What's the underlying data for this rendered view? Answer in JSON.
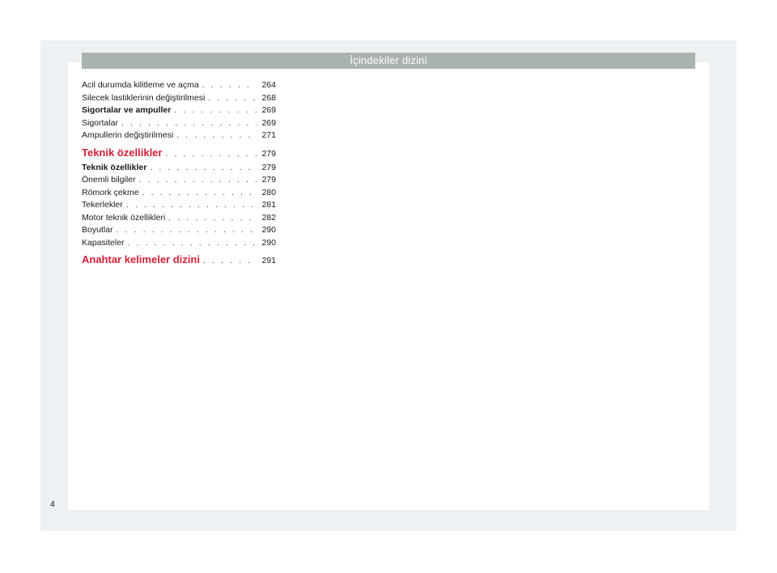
{
  "header": {
    "title": "İçindekiler dizini"
  },
  "toc": [
    {
      "label": "Acil durumda kilitleme ve açma",
      "page": "264",
      "style": "normal"
    },
    {
      "label": "Silecek lastiklerinin değiştirilmesi",
      "page": "268",
      "style": "normal"
    },
    {
      "label": "Sigortalar ve ampuller",
      "page": "269",
      "style": "bold"
    },
    {
      "label": "Sigortalar",
      "page": "269",
      "style": "normal"
    },
    {
      "label": "Ampullerin değiştirilmesi",
      "page": "271",
      "style": "normal"
    },
    {
      "label": "Teknik özellikler",
      "page": "279",
      "style": "section"
    },
    {
      "label": "Teknik özellikler",
      "page": "279",
      "style": "bold"
    },
    {
      "label": "Önemli bilgiler",
      "page": "279",
      "style": "normal"
    },
    {
      "label": "Römork çekme",
      "page": "280",
      "style": "normal"
    },
    {
      "label": "Tekerlekler",
      "page": "281",
      "style": "normal"
    },
    {
      "label": "Motor teknik özellikleri",
      "page": "282",
      "style": "normal"
    },
    {
      "label": "Boyutlar",
      "page": "290",
      "style": "normal"
    },
    {
      "label": "Kapasiteler",
      "page": "290",
      "style": "normal"
    },
    {
      "label": "Anahtar kelimeler dizini",
      "page": "291",
      "style": "section"
    }
  ],
  "footer": {
    "page_number": "4"
  },
  "colors": {
    "header_bar": "#a9b3b2",
    "section_heading": "#d4203a",
    "frame": "#eef1f3"
  }
}
